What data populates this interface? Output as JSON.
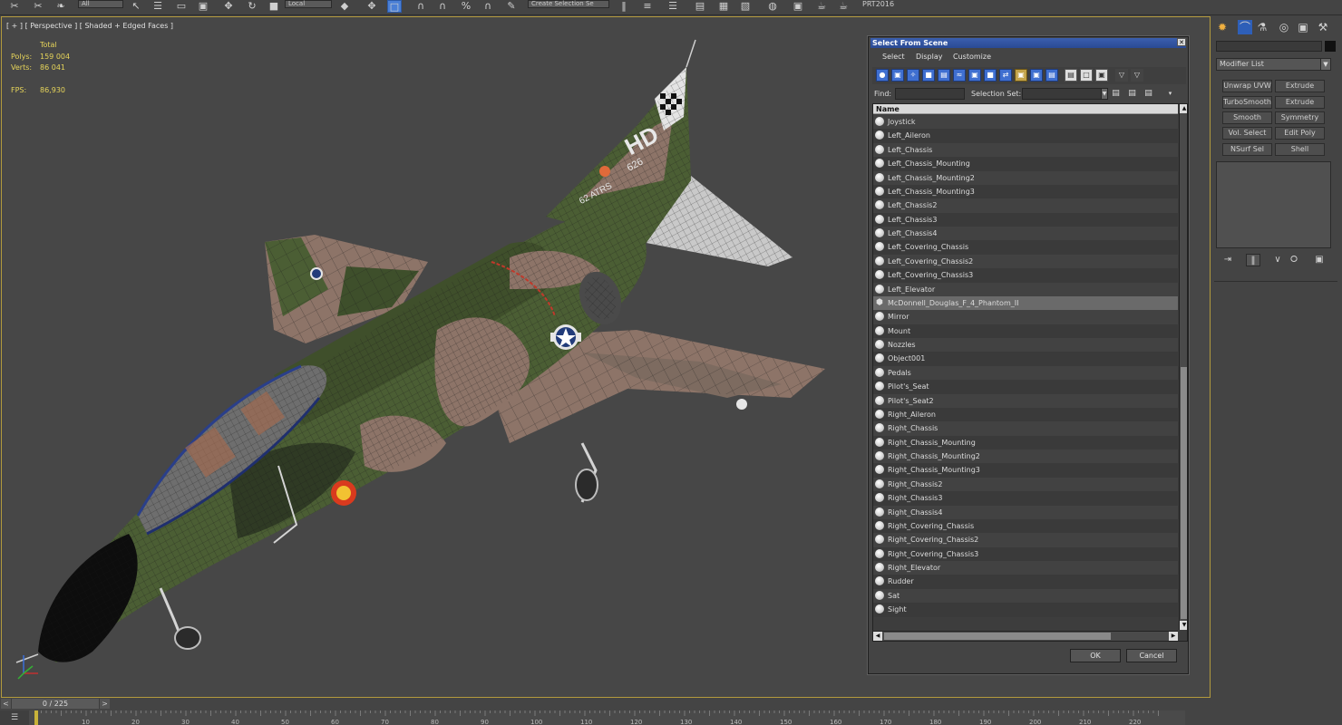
{
  "toolbar": {
    "coord_system": "Local",
    "selection_set": "Create Selection Se",
    "prt_label": "PRT2016",
    "filter_value": "All"
  },
  "viewport": {
    "label": "[ + ] [ Perspective ] [ Shaded + Edged Faces ]",
    "stats": {
      "total_label": "Total",
      "polys_label": "Polys:",
      "polys_value": "159 004",
      "verts_label": "Verts:",
      "verts_value": "86 041",
      "fps_label": "FPS:",
      "fps_value": "86,930"
    },
    "tail_text": "HD",
    "tail_serial": "626",
    "fuselage_text": "62 ATRS",
    "colors": {
      "background": "#474747",
      "camo_green": "#4b5e34",
      "camo_dark": "#2f3a24",
      "camo_tan": "#8d7468",
      "border_active": "#b39a3d"
    }
  },
  "dialog": {
    "title": "Select From Scene",
    "close_glyph": "✕",
    "menu": [
      "Select",
      "Display",
      "Customize"
    ],
    "find_label": "Find:",
    "find_value": "",
    "selection_set_label": "Selection Set:",
    "column_header": "Name",
    "objects": [
      {
        "name": "Joystick",
        "type": "geometry",
        "selected": false
      },
      {
        "name": "Left_Aileron",
        "type": "geometry",
        "selected": false
      },
      {
        "name": "Left_Chassis",
        "type": "geometry",
        "selected": false
      },
      {
        "name": "Left_Chassis_Mounting",
        "type": "geometry",
        "selected": false
      },
      {
        "name": "Left_Chassis_Mounting2",
        "type": "geometry",
        "selected": false
      },
      {
        "name": "Left_Chassis_Mounting3",
        "type": "geometry",
        "selected": false
      },
      {
        "name": "Left_Chassis2",
        "type": "geometry",
        "selected": false
      },
      {
        "name": "Left_Chassis3",
        "type": "geometry",
        "selected": false
      },
      {
        "name": "Left_Chassis4",
        "type": "geometry",
        "selected": false
      },
      {
        "name": "Left_Covering_Chassis",
        "type": "geometry",
        "selected": false
      },
      {
        "name": "Left_Covering_Chassis2",
        "type": "geometry",
        "selected": false
      },
      {
        "name": "Left_Covering_Chassis3",
        "type": "geometry",
        "selected": false
      },
      {
        "name": "Left_Elevator",
        "type": "geometry",
        "selected": false
      },
      {
        "name": "McDonnell_Douglas_F_4_Phantom_II",
        "type": "group",
        "selected": true
      },
      {
        "name": "Mirror",
        "type": "geometry",
        "selected": false
      },
      {
        "name": "Mount",
        "type": "geometry",
        "selected": false
      },
      {
        "name": "Nozzles",
        "type": "geometry",
        "selected": false
      },
      {
        "name": "Object001",
        "type": "geometry",
        "selected": false
      },
      {
        "name": "Pedals",
        "type": "geometry",
        "selected": false
      },
      {
        "name": "Pilot's_Seat",
        "type": "geometry",
        "selected": false
      },
      {
        "name": "Pilot's_Seat2",
        "type": "geometry",
        "selected": false
      },
      {
        "name": "Right_Aileron",
        "type": "geometry",
        "selected": false
      },
      {
        "name": "Right_Chassis",
        "type": "geometry",
        "selected": false
      },
      {
        "name": "Right_Chassis_Mounting",
        "type": "geometry",
        "selected": false
      },
      {
        "name": "Right_Chassis_Mounting2",
        "type": "geometry",
        "selected": false
      },
      {
        "name": "Right_Chassis_Mounting3",
        "type": "geometry",
        "selected": false
      },
      {
        "name": "Right_Chassis2",
        "type": "geometry",
        "selected": false
      },
      {
        "name": "Right_Chassis3",
        "type": "geometry",
        "selected": false
      },
      {
        "name": "Right_Chassis4",
        "type": "geometry",
        "selected": false
      },
      {
        "name": "Right_Covering_Chassis",
        "type": "geometry",
        "selected": false
      },
      {
        "name": "Right_Covering_Chassis2",
        "type": "geometry",
        "selected": false
      },
      {
        "name": "Right_Covering_Chassis3",
        "type": "geometry",
        "selected": false
      },
      {
        "name": "Right_Elevator",
        "type": "geometry",
        "selected": false
      },
      {
        "name": "Rudder",
        "type": "geometry",
        "selected": false
      },
      {
        "name": "Sat",
        "type": "geometry",
        "selected": false
      },
      {
        "name": "Sight",
        "type": "geometry",
        "selected": false
      }
    ],
    "ok_label": "OK",
    "cancel_label": "Cancel"
  },
  "command_panel": {
    "modifier_list_label": "Modifier List",
    "modifier_buttons": [
      [
        "Unwrap UVW",
        "Extrude"
      ],
      [
        "TurboSmooth",
        "Extrude"
      ],
      [
        "Smooth",
        "Symmetry"
      ],
      [
        "Vol. Select",
        "Edit Poly"
      ],
      [
        "NSurf Sel",
        "Shell"
      ]
    ]
  },
  "timeline": {
    "frame_label": "0 / 225",
    "ruler_ticks": [
      "10",
      "20",
      "30",
      "40",
      "50",
      "60",
      "70",
      "80",
      "90",
      "100",
      "110",
      "120",
      "130",
      "140",
      "150",
      "160",
      "170",
      "180",
      "190",
      "200",
      "210",
      "220"
    ]
  }
}
